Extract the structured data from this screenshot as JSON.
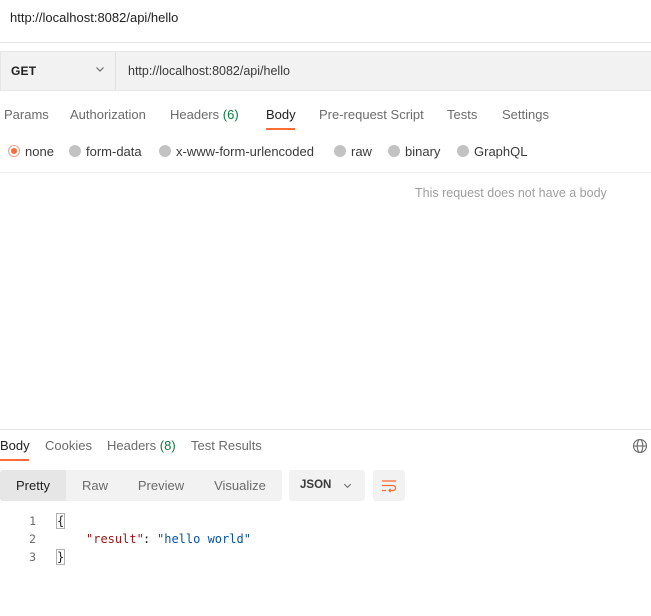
{
  "window": {
    "title": "http://localhost:8082/api/hello"
  },
  "request": {
    "method": "GET",
    "url": "http://localhost:8082/api/hello"
  },
  "request_tabs": {
    "params": "Params",
    "authorization": "Authorization",
    "headers": "Headers",
    "headers_count": "(6)",
    "body": "Body",
    "pre_request": "Pre-request Script",
    "tests": "Tests",
    "settings": "Settings"
  },
  "body_types": {
    "none": "none",
    "form_data": "form-data",
    "urlencoded": "x-www-form-urlencoded",
    "raw": "raw",
    "binary": "binary",
    "graphql": "GraphQL",
    "selected": "none"
  },
  "request_body": {
    "empty_message": "This request does not have a body"
  },
  "response_tabs": {
    "body": "Body",
    "cookies": "Cookies",
    "headers": "Headers",
    "headers_count": "(8)",
    "test_results": "Test Results"
  },
  "response_toolbar": {
    "pretty": "Pretty",
    "raw": "Raw",
    "preview": "Preview",
    "visualize": "Visualize",
    "language": "JSON"
  },
  "response_body": {
    "lines": [
      {
        "num": "1",
        "open": "{"
      },
      {
        "num": "2",
        "key": "\"result\"",
        "colon": ": ",
        "value": "\"hello world\""
      },
      {
        "num": "3",
        "close": "}"
      }
    ]
  },
  "colors": {
    "accent": "#ff6c37",
    "count_green": "#0a7d3b"
  }
}
